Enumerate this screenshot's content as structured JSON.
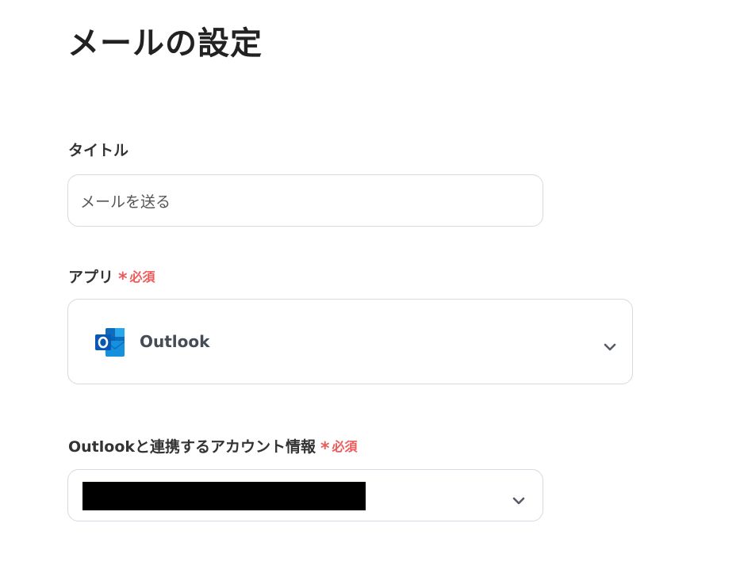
{
  "page": {
    "title": "メールの設定"
  },
  "title_field": {
    "label": "タイトル",
    "value": "メールを送る"
  },
  "app_field": {
    "label": "アプリ",
    "required_mark": "*",
    "required_text": "必須",
    "selected_app": "Outlook",
    "app_icon": "outlook-icon",
    "dropdown_icon": "chevron-down-icon"
  },
  "account_field": {
    "label": "Outlookと連携するアカウント情報",
    "required_mark": "*",
    "required_text": "必須",
    "dropdown_icon": "chevron-down-icon"
  },
  "colors": {
    "required": "#ef5a5a",
    "border": "#d7d9e3",
    "outlook_blue": "#0078d4"
  }
}
